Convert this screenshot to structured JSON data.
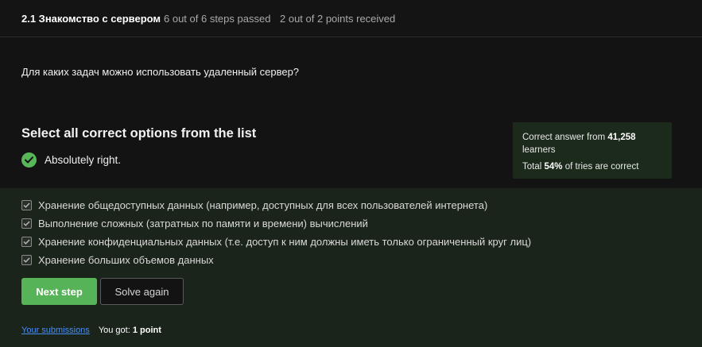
{
  "header": {
    "title": "2.1 Знакомство с сервером",
    "steps": "6 out of 6 steps passed",
    "points": "2 out of 2 points  received"
  },
  "question": "Для каких задач можно использовать удаленный сервер?",
  "section_title": "Select all correct options from the list",
  "result_text": "Absolutely right.",
  "stats": {
    "correct_prefix": "Correct answer from",
    "learners_count": "41,258",
    "learners_word": "learners",
    "total_prefix": "Total",
    "percent": "54%",
    "tries_suffix": "of tries are correct"
  },
  "options": [
    {
      "label": "Хранение общедоступных данных (например, доступных для всех пользователей интернета)",
      "checked": true
    },
    {
      "label": "Выполнение сложных (затратных по памяти и времени) вычислений",
      "checked": true
    },
    {
      "label": "Хранение конфиденциальных данных (т.е. доступ к ним должны иметь только ограниченный круг лиц)",
      "checked": true
    },
    {
      "label": "Хранение больших объемов данных",
      "checked": true
    }
  ],
  "buttons": {
    "next": "Next step",
    "solve_again": "Solve again"
  },
  "footer": {
    "submissions_link": "Your submissions",
    "you_got": "You got:",
    "score": "1 point"
  },
  "colors": {
    "accent_green": "#56b357",
    "link_blue": "#4a8cf0",
    "answers_bg": "#1b241a",
    "stats_bg": "#1c2a1c"
  }
}
